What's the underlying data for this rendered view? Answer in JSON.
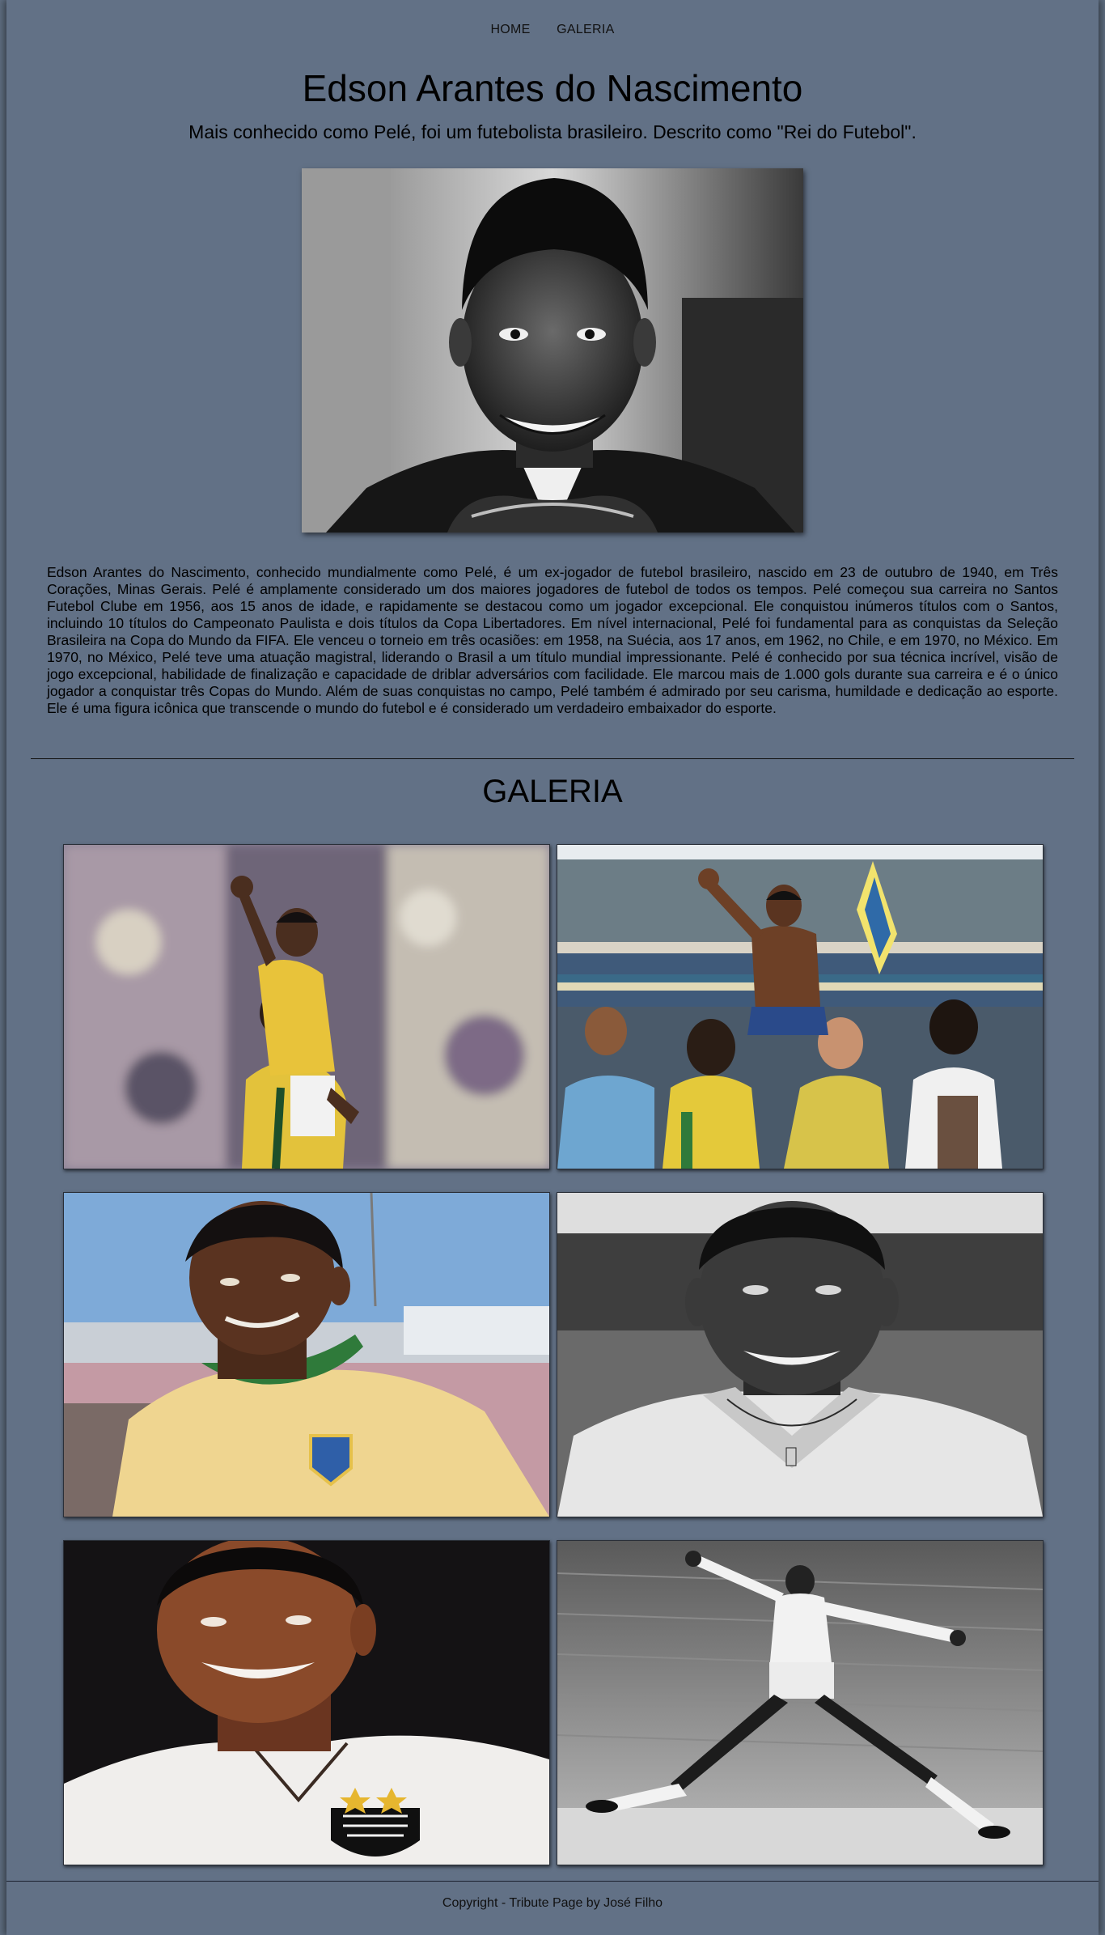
{
  "nav": {
    "items": [
      {
        "label": "HOME"
      },
      {
        "label": "GALERIA"
      }
    ]
  },
  "header": {
    "title": "Edson Arantes do Nascimento",
    "subtitle": "Mais conhecido como Pelé, foi um futebolista brasileiro. Descrito como \"Rei do Futebol\"."
  },
  "bio": {
    "text": "Edson Arantes do Nascimento, conhecido mundialmente como Pelé, é um ex-jogador de futebol brasileiro, nascido em 23 de outubro de 1940, em Três Corações, Minas Gerais. Pelé é amplamente considerado um dos maiores jogadores de futebol de todos os tempos. Pelé começou sua carreira no Santos Futebol Clube em 1956, aos 15 anos de idade, e rapidamente se destacou como um jogador excepcional. Ele conquistou inúmeros títulos com o Santos, incluindo 10 títulos do Campeonato Paulista e dois títulos da Copa Libertadores. Em nível internacional, Pelé foi fundamental para as conquistas da Seleção Brasileira na Copa do Mundo da FIFA. Ele venceu o torneio em três ocasiões: em 1958, na Suécia, aos 17 anos, em 1962, no Chile, e em 1970, no México. Em 1970, no México, Pelé teve uma atuação magistral, liderando o Brasil a um título mundial impressionante. Pelé é conhecido por sua técnica incrível, visão de jogo excepcional, habilidade de finalização e capacidade de driblar adversários com facilidade. Ele marcou mais de 1.000 gols durante sua carreira e é o único jogador a conquistar três Copas do Mundo. Além de suas conquistas no campo, Pelé também é admirado por seu carisma, humildade e dedicação ao esporte. Ele é uma figura icônica que transcende o mundo do futebol e é considerado um verdadeiro embaixador do esporte."
  },
  "gallery": {
    "title": "GALERIA"
  },
  "footer": {
    "text": "Copyright - Tribute Page by José Filho"
  },
  "colors": {
    "background": "#627186",
    "text": "#000000",
    "yellow_shirt": "#e8c33a",
    "green_trim": "#2f7a3a"
  }
}
